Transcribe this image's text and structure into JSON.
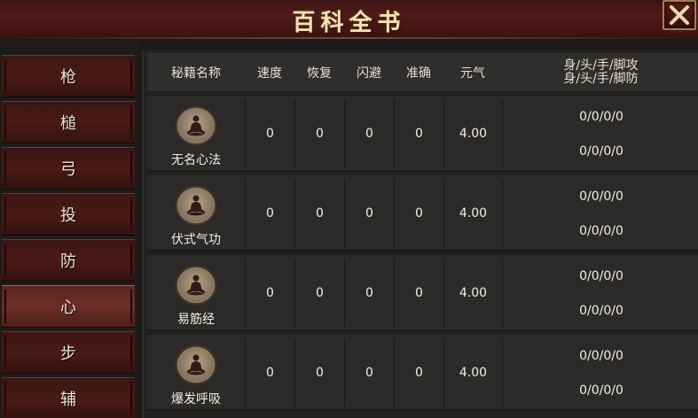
{
  "window": {
    "title": "百科全书"
  },
  "sidebar": {
    "items": [
      {
        "label": "枪"
      },
      {
        "label": "槌"
      },
      {
        "label": "弓"
      },
      {
        "label": "投"
      },
      {
        "label": "防"
      },
      {
        "label": "心"
      },
      {
        "label": "步"
      },
      {
        "label": "辅"
      }
    ],
    "active_label": "心"
  },
  "table": {
    "headers": {
      "name": "秘籍名称",
      "speed": "速度",
      "recover": "恢复",
      "dodge": "闪避",
      "accuracy": "准确",
      "qi": "元气",
      "attack": "身/头/手/脚攻",
      "defense": "身/头/手/脚防"
    },
    "rows": [
      {
        "name": "无名心法",
        "icon": "meditation-icon",
        "speed": "0",
        "recover": "0",
        "dodge": "0",
        "accuracy": "0",
        "qi": "4.00",
        "attack": "0/0/0/0",
        "defense": "0/0/0/0"
      },
      {
        "name": "伏式气功",
        "icon": "meditation-icon",
        "speed": "0",
        "recover": "0",
        "dodge": "0",
        "accuracy": "0",
        "qi": "4.00",
        "attack": "0/0/0/0",
        "defense": "0/0/0/0"
      },
      {
        "name": "易筋经",
        "icon": "meditation-icon",
        "speed": "0",
        "recover": "0",
        "dodge": "0",
        "accuracy": "0",
        "qi": "4.00",
        "attack": "0/0/0/0",
        "defense": "0/0/0/0"
      },
      {
        "name": "爆发呼吸",
        "icon": "meditation-icon",
        "speed": "0",
        "recover": "0",
        "dodge": "0",
        "accuracy": "0",
        "qi": "4.00",
        "attack": "0/0/0/0",
        "defense": "0/0/0/0"
      }
    ]
  },
  "colors": {
    "title_gold": "#f3e2b8",
    "titlebar_red": "#521a18",
    "panel_bg": "#232120",
    "row_bg": "#2c2a28"
  }
}
